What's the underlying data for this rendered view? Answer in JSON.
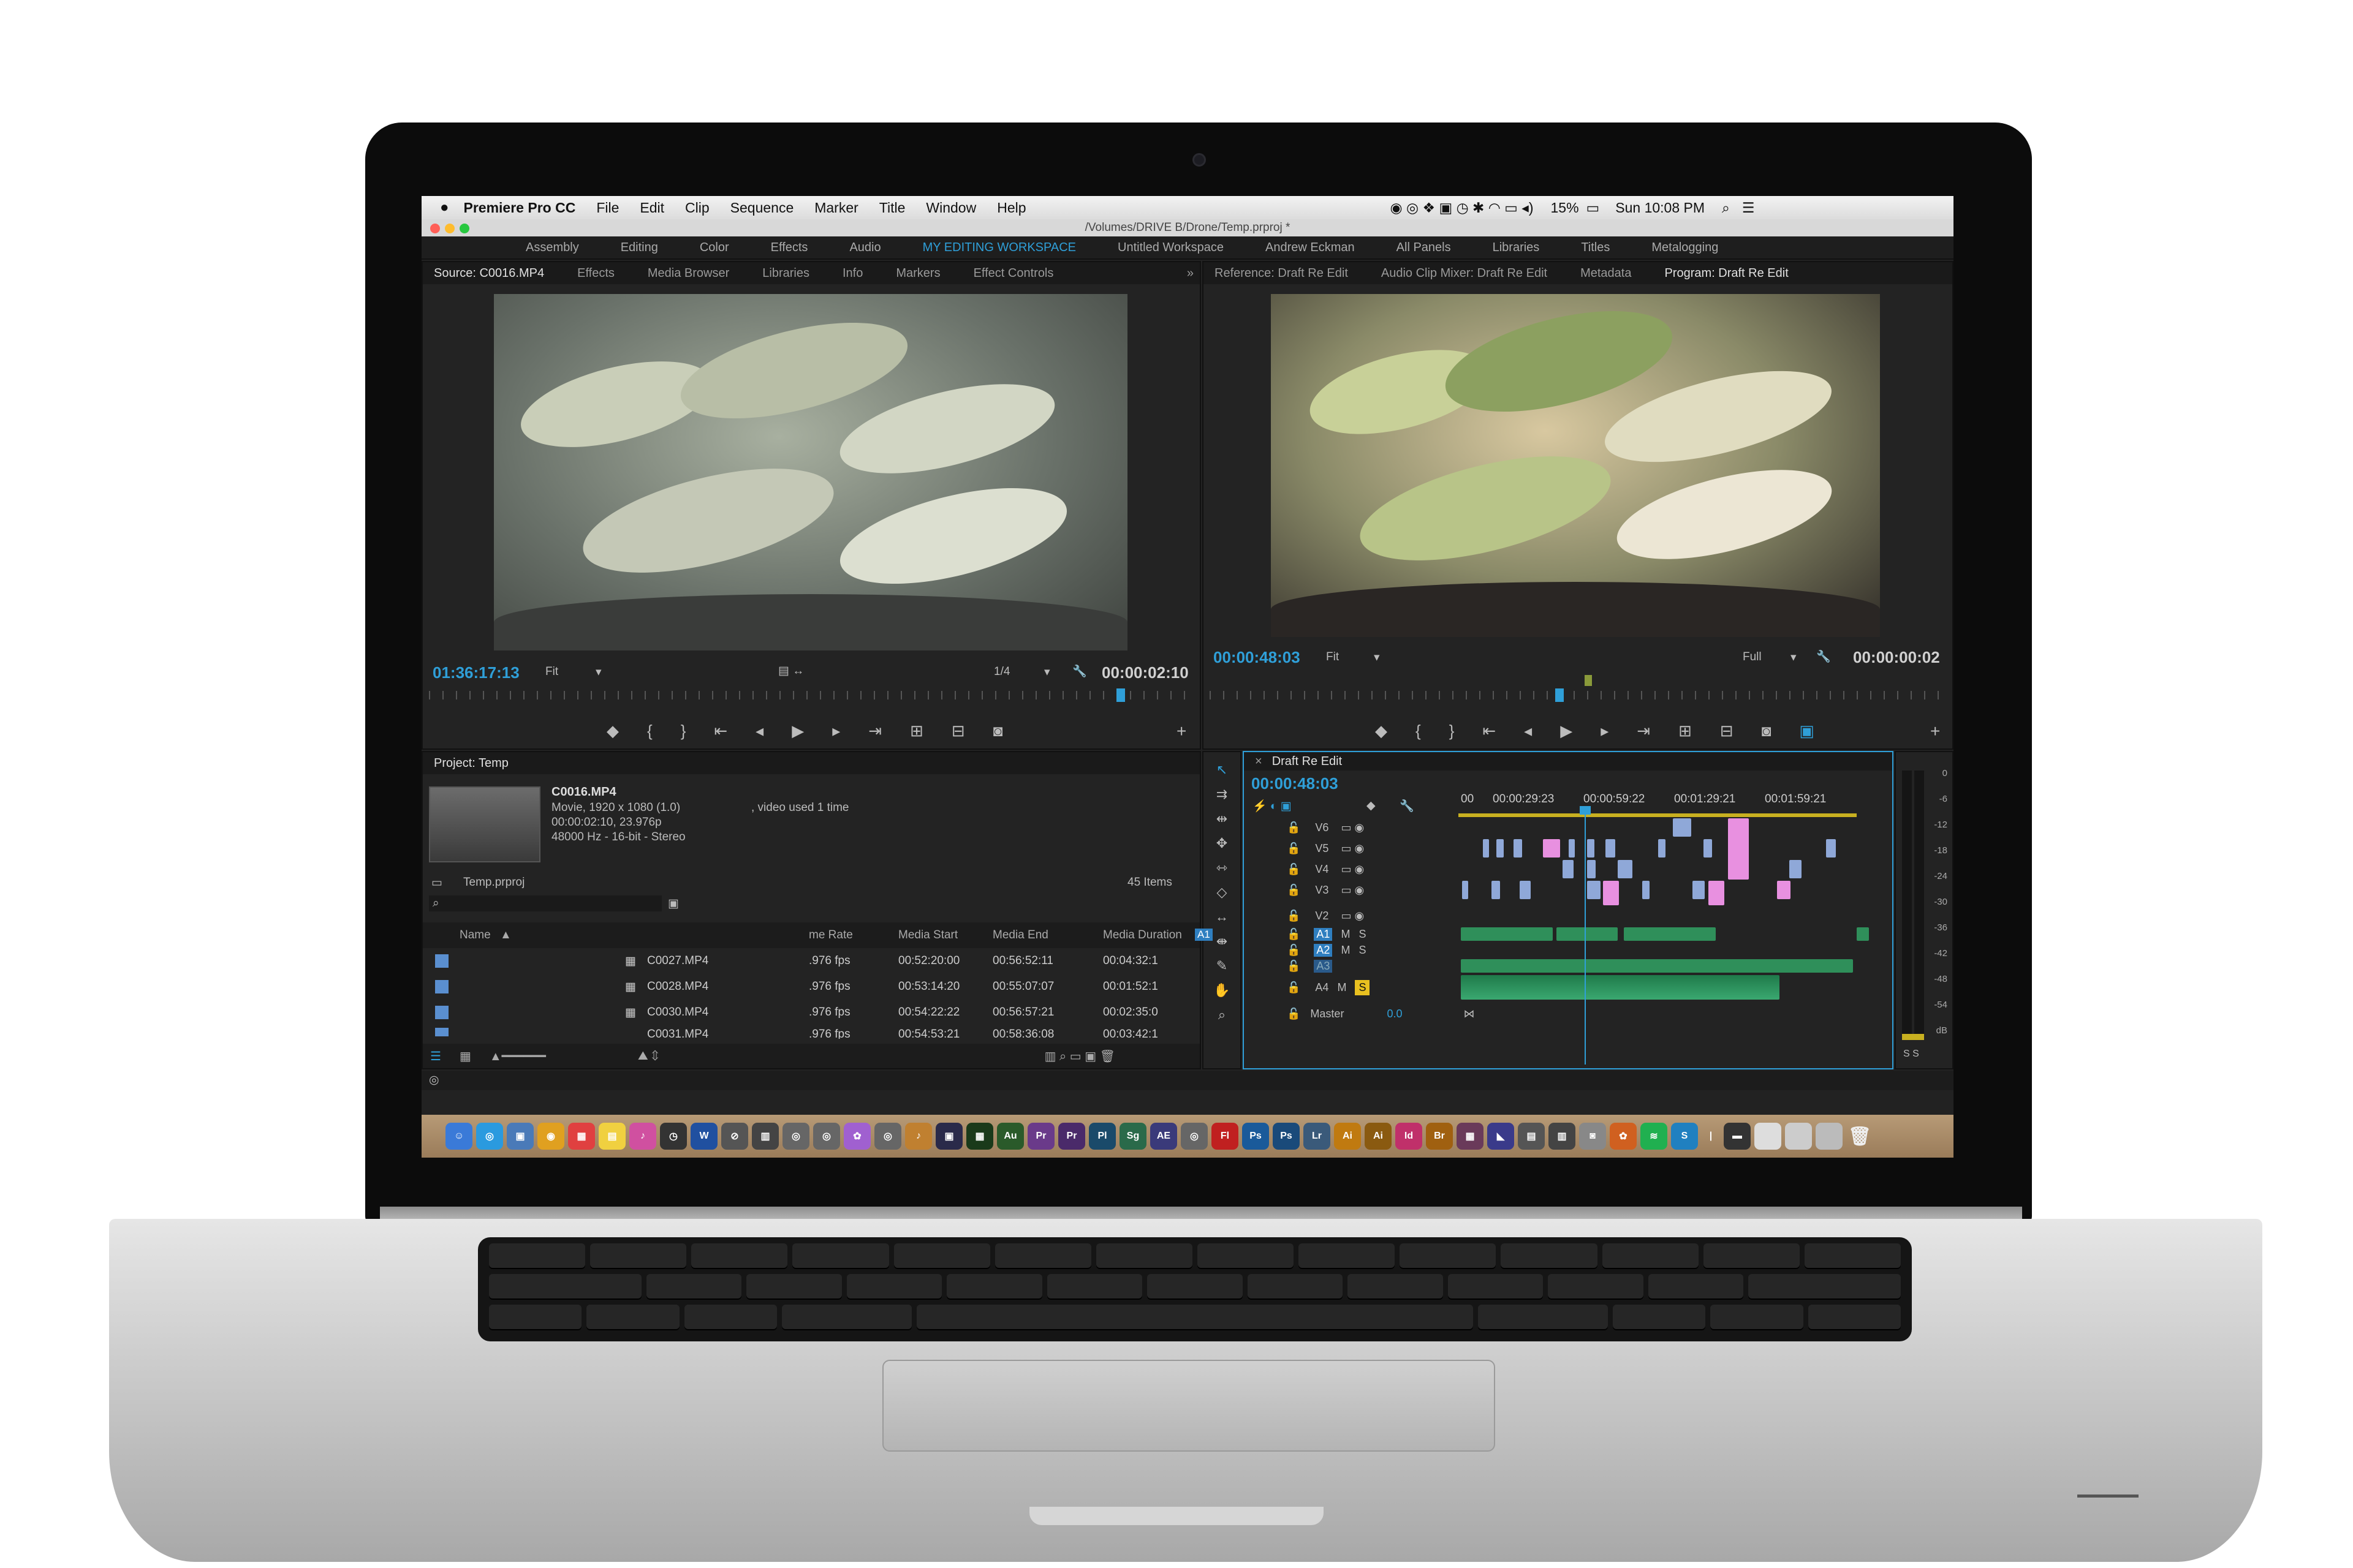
{
  "menubar": {
    "app": "Premiere Pro CC",
    "items": [
      "File",
      "Edit",
      "Clip",
      "Sequence",
      "Marker",
      "Title",
      "Window",
      "Help"
    ],
    "battery": "15%",
    "clock": "Sun 10:08 PM"
  },
  "titlebar": {
    "path": "/Volumes/DRIVE B/Drone/Temp.prproj *"
  },
  "workspaces": [
    "Assembly",
    "Editing",
    "Color",
    "Effects",
    "Audio",
    "MY EDITING WORKSPACE",
    "Untitled Workspace",
    "Andrew Eckman",
    "All Panels",
    "Libraries",
    "Titles",
    "Metalogging"
  ],
  "source": {
    "tabs": [
      "Source: C0016.MP4",
      "Effects",
      "Media Browser",
      "Libraries",
      "Info",
      "Markers",
      "Effect Controls"
    ],
    "timecode": "01:36:17:13",
    "fit": "Fit",
    "resolution": "1/4",
    "duration": "00:00:02:10"
  },
  "program": {
    "tabs": [
      "Reference: Draft Re Edit",
      "Audio Clip Mixer: Draft Re Edit",
      "Metadata",
      "Program: Draft Re Edit"
    ],
    "timecode": "00:00:48:03",
    "fit": "Fit",
    "resolution": "Full",
    "duration": "00:00:00:02"
  },
  "project": {
    "title": "Project: Temp",
    "clip_name": "C0016.MP4",
    "clip_info1": "Movie, 1920 x 1080 (1.0)",
    "clip_info1b": ", video used 1 time",
    "clip_info2": "00:00:02:10, 23.976p",
    "clip_info3": "48000 Hz - 16-bit - Stereo",
    "file": "Temp.prproj",
    "count": "45 Items",
    "columns": [
      "Name",
      "me Rate",
      "Media Start",
      "Media End",
      "Media Duration"
    ],
    "rows": [
      {
        "name": "C0027.MP4",
        "rate": ".976 fps",
        "start": "00:52:20:00",
        "end": "00:56:52:11",
        "dur": "00:04:32:1"
      },
      {
        "name": "C0028.MP4",
        "rate": ".976 fps",
        "start": "00:53:14:20",
        "end": "00:55:07:07",
        "dur": "00:01:52:1"
      },
      {
        "name": "C0030.MP4",
        "rate": ".976 fps",
        "start": "00:54:22:22",
        "end": "00:56:57:21",
        "dur": "00:02:35:0"
      },
      {
        "name": "C0031.MP4",
        "rate": ".976 fps",
        "start": "00:54:53:21",
        "end": "00:58:36:08",
        "dur": "00:03:42:1"
      }
    ]
  },
  "timeline": {
    "title": "Draft Re Edit",
    "timecode": "00:00:48:03",
    "ruler": [
      "00",
      "00:00:29:23",
      "00:00:59:22",
      "00:01:29:21",
      "00:01:59:21"
    ],
    "tracks": [
      "V6",
      "V5",
      "V4",
      "V3",
      "V2",
      "A1",
      "A2",
      "A3",
      "A4"
    ],
    "src_patch": "A1",
    "master": "Master",
    "master_val": "0.0",
    "m": "M",
    "s": "S"
  },
  "meter": {
    "ticks": [
      "0",
      "-6",
      "-12",
      "-18",
      "-24",
      "-30",
      "-36",
      "-42",
      "-48",
      "-54",
      "dB"
    ],
    "footer": "S  S"
  },
  "dock": [
    "Au",
    "Pr",
    "Pr",
    "Pl",
    "Sg",
    "AE",
    "Fl",
    "Ps",
    "Ps",
    "Lr",
    "Ai",
    "Ai",
    "Id",
    "Br"
  ],
  "colors": {
    "accent": "#2f9fd8",
    "panel": "#232323",
    "dark": "#1a1a1a"
  }
}
